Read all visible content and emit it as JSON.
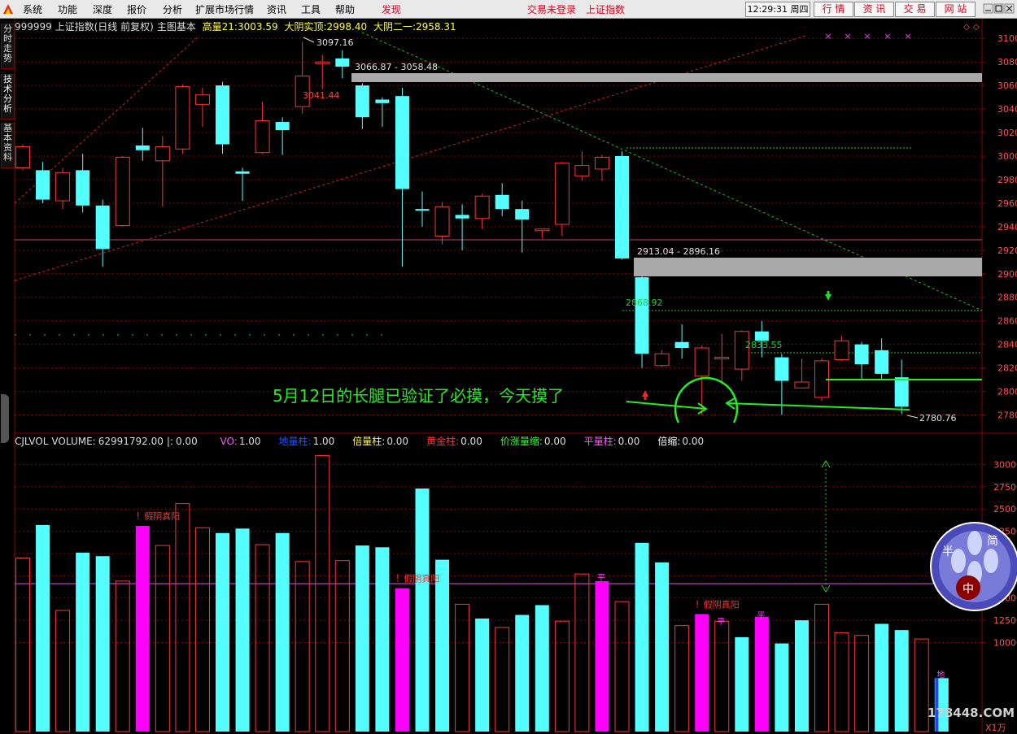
{
  "menu": {
    "items": [
      "系统",
      "功能",
      "深度",
      "报价",
      "分析",
      "扩展市场行情",
      "资讯",
      "工具",
      "帮助"
    ],
    "discover": "发现",
    "login_status": "交易未登录",
    "index_name": "上证指数",
    "time": "12:29:31 周四",
    "buttons": [
      "行 情",
      "资 讯",
      "交 易",
      "网 站"
    ]
  },
  "sidebar": [
    "分时走势",
    "技术分析",
    "基本资料"
  ],
  "header": {
    "code_title": "999999 上证指数(日线 前复权)",
    "template": "主图基本",
    "high_label": "高量21:",
    "high_value": "3003.59",
    "yin_label": "大阴实顶:",
    "yin_value": "2998.40",
    "yin2_label": "大阴二一:",
    "yin2_value": "2958.31"
  },
  "volume_header": {
    "name": "CJLVOL",
    "volume_label": "VOLUME:",
    "volume_value": "62991792.00",
    "sep": "|:",
    "sep_value": "0.00",
    "items": [
      {
        "label": "VO:",
        "value": "1.00",
        "color": "#ff55ff"
      },
      {
        "label": "地量柱:",
        "value": "1.00",
        "color": "#2255ff"
      },
      {
        "label": "倍量柱:",
        "value": "0.00",
        "color": "#ffff33"
      },
      {
        "label": "黄金柱:",
        "value": "0.00",
        "color": "#ff3333"
      },
      {
        "label": "价涨量缩:",
        "value": "0.00",
        "color": "#33ff33"
      },
      {
        "label": "平量柱:",
        "value": "0.00",
        "color": "#ff55ff"
      },
      {
        "label": "倍缩:",
        "value": "0.00",
        "color": "#ffffff"
      }
    ]
  },
  "annotations": {
    "note": "5月12日的长腿已验证了必摸，今天摸了",
    "high_mark": "3097.16",
    "low_mark": "2780.76",
    "gap_top": "3066.87 - 3058.48",
    "gap_bottom": "2913.04 - 2896.16",
    "level_3041": "3041.44",
    "level_2868": "2868.92",
    "level_2833": "2833.55",
    "fake_yin": "假阴真阳",
    "flat": "平",
    "di": "地",
    "unit": "X1万",
    "watermark": "178448.COM",
    "logo_chars": [
      "半",
      "简",
      "中"
    ]
  },
  "colors": {
    "up": "#ff3333",
    "down": "#54ffff",
    "magenta": "#ff00ff",
    "green": "#00e000",
    "gap": "#a9a9a9",
    "grid": "#8b0000"
  },
  "chart_data": [
    {
      "type": "candlestick",
      "yrange": [
        2770,
        3105
      ],
      "y_ticks": [
        2780,
        2800,
        2820,
        2840,
        2860,
        2880,
        2900,
        2920,
        2940,
        2960,
        2980,
        3000,
        3020,
        3040,
        3060,
        3080,
        3100
      ],
      "candles": [
        {
          "o": 2990,
          "c": 3008,
          "h": 3010,
          "l": 2988
        },
        {
          "o": 2988,
          "c": 2963,
          "h": 2995,
          "l": 2960
        },
        {
          "o": 2962,
          "c": 2986,
          "h": 2990,
          "l": 2955
        },
        {
          "o": 2988,
          "c": 2958,
          "h": 3002,
          "l": 2952
        },
        {
          "o": 2958,
          "c": 2921,
          "h": 2963,
          "l": 2906
        },
        {
          "o": 2941,
          "c": 2999,
          "h": 3000,
          "l": 2940
        },
        {
          "o": 3009,
          "c": 3005,
          "h": 3024,
          "l": 2996
        },
        {
          "o": 2996,
          "c": 3008,
          "h": 3017,
          "l": 2957
        },
        {
          "o": 3006,
          "c": 3059,
          "h": 3061,
          "l": 3002
        },
        {
          "o": 3044,
          "c": 3052,
          "h": 3058,
          "l": 3025
        },
        {
          "o": 3060,
          "c": 3010,
          "h": 3063,
          "l": 3002
        },
        {
          "o": 2987,
          "c": 2985,
          "h": 2990,
          "l": 2962
        },
        {
          "o": 3003,
          "c": 3030,
          "h": 3046,
          "l": 3002
        },
        {
          "o": 3029,
          "c": 3022,
          "h": 3033,
          "l": 3001
        },
        {
          "o": 3042,
          "c": 3068,
          "h": 3097.16,
          "l": 3036
        },
        {
          "o": 3080,
          "c": 3080,
          "h": 3086,
          "l": 3057
        },
        {
          "o": 3083,
          "c": 3076,
          "h": 3090,
          "l": 3066
        },
        {
          "o": 3060,
          "c": 3033,
          "h": 3062,
          "l": 3023
        },
        {
          "o": 3048,
          "c": 3045,
          "h": 3050,
          "l": 3025
        },
        {
          "o": 3051,
          "c": 2972,
          "h": 3058,
          "l": 2906
        },
        {
          "o": 2955,
          "c": 2954,
          "h": 2970,
          "l": 2940
        },
        {
          "o": 2932,
          "c": 2957,
          "h": 2961,
          "l": 2925
        },
        {
          "o": 2950,
          "c": 2947,
          "h": 2959,
          "l": 2920
        },
        {
          "o": 2947,
          "c": 2966,
          "h": 2968,
          "l": 2938
        },
        {
          "o": 2967,
          "c": 2955,
          "h": 2977,
          "l": 2949
        },
        {
          "o": 2955,
          "c": 2946,
          "h": 2962,
          "l": 2918
        },
        {
          "o": 2937,
          "c": 2938,
          "h": 2938,
          "l": 2930
        },
        {
          "o": 2942,
          "c": 2994,
          "h": 2995,
          "l": 2932
        },
        {
          "o": 2983,
          "c": 2992,
          "h": 3004,
          "l": 2979
        },
        {
          "o": 2989,
          "c": 2999,
          "h": 3001,
          "l": 2979
        },
        {
          "o": 3000,
          "c": 2913,
          "h": 3004,
          "l": 2912
        },
        {
          "o": 2897,
          "c": 2832,
          "h": 2898,
          "l": 2820
        },
        {
          "o": 2822,
          "c": 2832,
          "h": 2835,
          "l": 2821
        },
        {
          "o": 2842,
          "c": 2837,
          "h": 2857,
          "l": 2828
        },
        {
          "o": 2813,
          "c": 2837,
          "h": 2839,
          "l": 2780
        },
        {
          "o": 2829,
          "c": 2829,
          "h": 2849,
          "l": 2806
        },
        {
          "o": 2819,
          "c": 2851,
          "h": 2852,
          "l": 2809
        },
        {
          "o": 2851,
          "c": 2843,
          "h": 2860,
          "l": 2829
        },
        {
          "o": 2829,
          "c": 2809,
          "h": 2832,
          "l": 2780
        },
        {
          "o": 2803,
          "c": 2808,
          "h": 2828,
          "l": 2803
        },
        {
          "o": 2795,
          "c": 2826,
          "h": 2828,
          "l": 2792
        },
        {
          "o": 2827,
          "c": 2843,
          "h": 2847,
          "l": 2826
        },
        {
          "o": 2840,
          "c": 2823,
          "h": 2842,
          "l": 2810
        },
        {
          "o": 2835,
          "c": 2815,
          "h": 2845,
          "l": 2810
        },
        {
          "o": 2812,
          "c": 2787,
          "h": 2827,
          "l": 2780.76
        }
      ]
    },
    {
      "type": "bar",
      "unit": "X1万",
      "yrange": [
        0,
        31500
      ],
      "y_ticks": [
        10000,
        12500,
        15000,
        17500,
        20000,
        22500,
        25000,
        27500,
        30000
      ],
      "values": [
        19500,
        23200,
        13600,
        20100,
        19700,
        16900,
        23100,
        20900,
        25600,
        22900,
        22300,
        22800,
        21000,
        22300,
        19100,
        31000,
        19200,
        20900,
        20700,
        16100,
        27300,
        19300,
        14300,
        12700,
        11700,
        13100,
        14200,
        12400,
        17700,
        16900,
        14600,
        21200,
        19000,
        11900,
        13200,
        12400,
        10600,
        12900,
        9900,
        12500,
        14300,
        11100,
        10800,
        12100,
        11400,
        10400,
        6000
      ],
      "colors": [
        "red",
        "cyan",
        "red",
        "cyan",
        "cyan",
        "red",
        "magenta",
        "red",
        "red",
        "red",
        "cyan",
        "cyan",
        "red",
        "cyan",
        "red",
        "red",
        "red",
        "cyan",
        "cyan",
        "magenta",
        "cyan",
        "cyan",
        "red",
        "cyan",
        "red",
        "cyan",
        "cyan",
        "red",
        "red",
        "magenta",
        "red",
        "cyan",
        "cyan",
        "red",
        "magenta",
        "red",
        "cyan",
        "magenta",
        "cyan",
        "cyan",
        "red",
        "red",
        "red",
        "cyan",
        "cyan",
        "red",
        "cyan"
      ]
    }
  ]
}
